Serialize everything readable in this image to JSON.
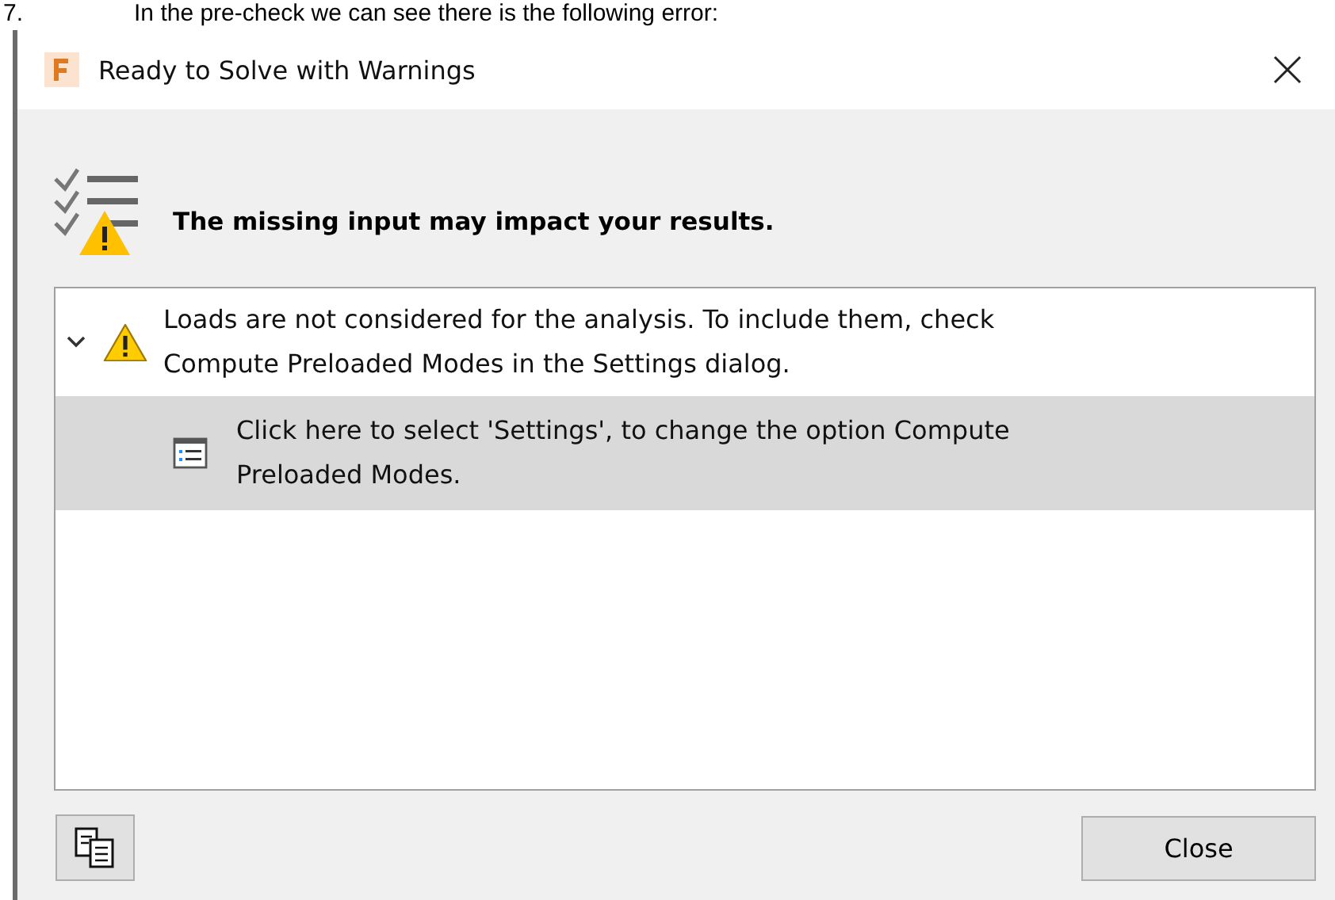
{
  "document_line": {
    "number": "7.",
    "text": "In the pre-check we can see there is the following error:"
  },
  "window": {
    "title": "Ready to Solve with Warnings"
  },
  "header": {
    "message": "The missing input may impact your results."
  },
  "issues": [
    {
      "text": "Loads are not considered for the analysis. To include them, check Compute Preloaded Modes in the Settings dialog.",
      "expanded": true,
      "children": [
        {
          "text": "Click here to select 'Settings', to change the option Compute Preloaded Modes.",
          "selected": true
        }
      ]
    }
  ],
  "footer": {
    "close_label": "Close"
  }
}
